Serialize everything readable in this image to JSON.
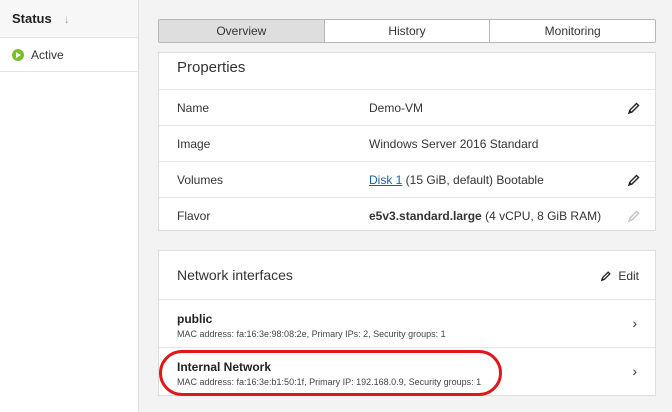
{
  "left": {
    "header": {
      "label": "Status",
      "sort_icon": "arrow-down-icon"
    },
    "rows": [
      {
        "label": "Active",
        "icon": "play-circle-icon",
        "color": "#7bbf2a"
      }
    ]
  },
  "tabs": [
    {
      "label": "Overview",
      "active": true
    },
    {
      "label": "History",
      "active": false
    },
    {
      "label": "Monitoring",
      "active": false
    }
  ],
  "properties": {
    "title": "Properties",
    "rows": [
      {
        "key": "Name",
        "value": "Demo-VM",
        "editable": true
      },
      {
        "key": "Image",
        "value": "Windows Server 2016 Standard",
        "editable": false
      },
      {
        "key": "Volumes",
        "link": "Disk 1",
        "rest": " (15 GiB, default) Bootable",
        "editable": true
      },
      {
        "key": "Flavor",
        "bold": "e5v3.standard.large",
        "rest": " (4 vCPU, 8 GiB RAM)",
        "editable": false
      }
    ]
  },
  "network": {
    "title": "Network interfaces",
    "edit_label": "Edit",
    "items": [
      {
        "name": "public",
        "meta": "MAC address: fa:16:3e:98:08:2e, Primary IPs: 2, Security groups: 1"
      },
      {
        "name": "Internal Network",
        "meta": "MAC address: fa:16:3e:b1:50:1f, Primary IP: 192.168.0.9, Security groups: 1"
      }
    ]
  },
  "colors": {
    "highlight": "#e0181b",
    "link": "#1a5ea8",
    "active_status": "#7bbf2a"
  }
}
